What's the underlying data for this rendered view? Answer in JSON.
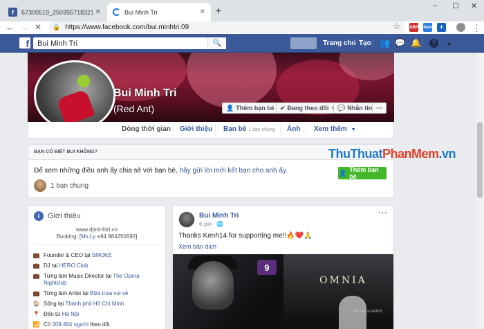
{
  "browser": {
    "tabs": [
      {
        "title": "67300519_2503557183211319_8",
        "active": false
      },
      {
        "title": "Bui Minh Tri",
        "active": true
      }
    ],
    "url": "https://www.facebook.com/bui.minhtri.09",
    "new_tab": "+",
    "window_controls": [
      "–",
      "☐",
      "✕"
    ]
  },
  "fb": {
    "logo": "f",
    "search_value": "Bui Minh Tri",
    "nav": {
      "home": "Trang chủ",
      "create": "Tạo"
    }
  },
  "profile": {
    "name": "Bui Minh Tri",
    "alt_name": "(Red Ant)",
    "buttons": {
      "add_friend": "Thêm bạn bè",
      "follow": "Đang theo dõi",
      "message": "Nhắn tin",
      "more": "···"
    },
    "tabs": {
      "timeline": "Dòng thời gian",
      "about": "Giới thiệu",
      "friends": "Bạn bè",
      "friends_sub": "1 bạn chung",
      "photos": "Ảnh",
      "more": "Xem thêm"
    }
  },
  "know_card": {
    "header": "BẠN CÓ BIẾT BUI KHÔNG?",
    "text_prefix": "Để xem những điều anh ấy chia sẻ với bạn bè, ",
    "text_link": "hãy gửi lời mời kết bạn cho anh ấy.",
    "button": "Thêm bạn bè",
    "mutual": "1 bạn chung"
  },
  "watermark": {
    "part1": "ThuThuat",
    "part2": "PhanMem",
    "part3": ".vn"
  },
  "intro": {
    "title": "Giới thiệu",
    "bio_line1": "www.djminhtri.vn",
    "bio_line2_prefix": "Booking: [",
    "bio_line2_link": "Ms.Ly",
    "bio_line2_suffix": " +84 984250692]",
    "rows": [
      {
        "prefix": "Founder & CEO tại ",
        "link": "SMOKE"
      },
      {
        "prefix": "DJ tại ",
        "link": "HERO Club"
      },
      {
        "prefix": "Từng làm Music Director tại ",
        "link": "The Opera Nightclub"
      },
      {
        "prefix": "Từng làm Artist tại ",
        "link": "Bữa trưa vui vẻ"
      },
      {
        "prefix": "Sống tại ",
        "link": "Thành phố Hồ Chí Minh"
      },
      {
        "prefix": "Đến từ ",
        "link": "Hà Nội"
      },
      {
        "prefix": "Có ",
        "link": "209.464 người",
        "suffix": " theo dõi"
      }
    ]
  },
  "post": {
    "author": "Bui Minh Tri",
    "time": "6 giờ · 🌐",
    "text": "Thanks Kenh14 for supporting me!!🔥❤️🙏",
    "translate": "Xem bản dịch",
    "more": "···",
    "photo_tag": "9",
    "photo_sign": "OMNIA",
    "photo_sign_small": "VIP TABLE ENTRY"
  },
  "colors": {
    "fb_blue": "#3b5998",
    "link": "#365899",
    "green": "#42b72a"
  }
}
